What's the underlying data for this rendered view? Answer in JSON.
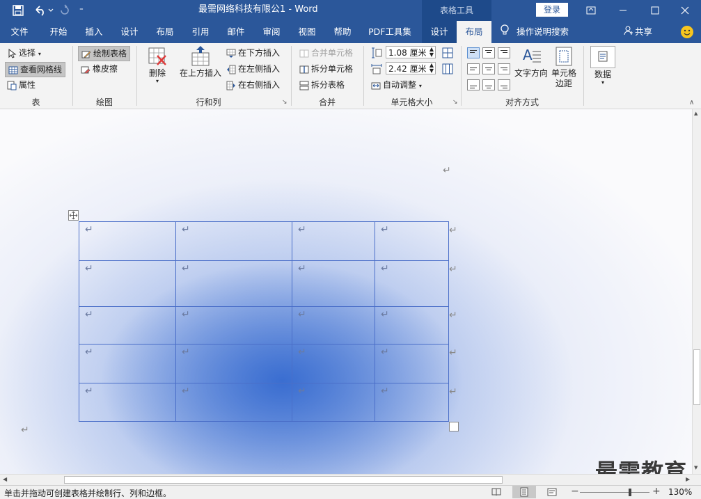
{
  "titlebar": {
    "doc_title": "最需网络科技有限公1",
    "separator": " - ",
    "app_name": "Word",
    "context_group": "表格工具",
    "login_label": "登录",
    "save_icon": "save-icon",
    "undo_icon": "undo-icon",
    "redo_icon": "redo-icon"
  },
  "tabs": {
    "file": "文件",
    "home": "开始",
    "insert": "插入",
    "design": "设计",
    "layout": "布局",
    "references": "引用",
    "mailings": "邮件",
    "review": "审阅",
    "view": "视图",
    "help": "帮助",
    "pdf": "PDF工具集",
    "table_design": "设计",
    "table_layout": "布局",
    "tell_me": "操作说明搜索",
    "share": "共享"
  },
  "ribbon": {
    "table_group": {
      "label": "表",
      "select": "选择",
      "view_gridlines": "查看网格线",
      "properties": "属性"
    },
    "draw_group": {
      "label": "绘图",
      "draw_table": "绘制表格",
      "eraser": "橡皮擦"
    },
    "rows_group": {
      "label": "行和列",
      "delete": "删除",
      "insert_above": "在上方插入",
      "insert_below": "在下方插入",
      "insert_left": "在左侧插入",
      "insert_right": "在右侧插入"
    },
    "merge_group": {
      "label": "合并",
      "merge_cells": "合并单元格",
      "split_cells": "拆分单元格",
      "split_table": "拆分表格"
    },
    "size_group": {
      "label": "单元格大小",
      "height": "1.08 厘米",
      "width": "2.42 厘米",
      "autofit": "自动调整"
    },
    "align_group": {
      "label": "对齐方式",
      "text_direction": "文字方向",
      "cell_margins_1": "单元格",
      "cell_margins_2": "边距"
    },
    "data_group": {
      "data": "数据"
    }
  },
  "document": {
    "paragraph_mark": "↵",
    "table_rows": 5,
    "table_cols": 4
  },
  "statusbar": {
    "hint": "单击并拖动可创建表格并绘制行、列和边框。",
    "zoom": "130%",
    "zoom_level": 0.72
  },
  "watermark": "最需教育",
  "colors": {
    "brand": "#2b579a",
    "table_border": "#4a6ec8"
  }
}
